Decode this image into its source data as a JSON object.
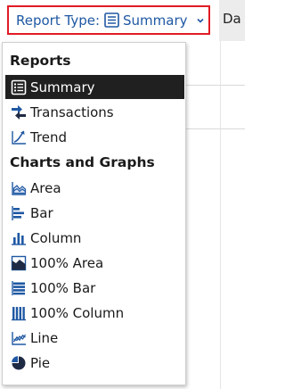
{
  "header": {
    "report_type_label": "Report Type:",
    "report_type_value": "Summary",
    "next_tab_label": "Da"
  },
  "menu": {
    "sections": [
      {
        "title": "Reports",
        "items": [
          {
            "label": "Summary",
            "icon": "summary-icon",
            "selected": true
          },
          {
            "label": "Transactions",
            "icon": "transactions-icon"
          },
          {
            "label": "Trend",
            "icon": "trend-icon"
          }
        ]
      },
      {
        "title": "Charts and Graphs",
        "items": [
          {
            "label": "Area",
            "icon": "area-chart-icon"
          },
          {
            "label": "Bar",
            "icon": "bar-chart-icon"
          },
          {
            "label": "Column",
            "icon": "column-chart-icon"
          },
          {
            "label": "100% Area",
            "icon": "area-100-chart-icon"
          },
          {
            "label": "100% Bar",
            "icon": "bar-100-chart-icon"
          },
          {
            "label": "100% Column",
            "icon": "column-100-chart-icon"
          },
          {
            "label": "Line",
            "icon": "line-chart-icon"
          },
          {
            "label": "Pie",
            "icon": "pie-chart-icon"
          }
        ]
      }
    ]
  },
  "colors": {
    "accent_blue": "#1f58a3",
    "highlight_border": "#e01b24",
    "selected_bg": "#202020"
  }
}
